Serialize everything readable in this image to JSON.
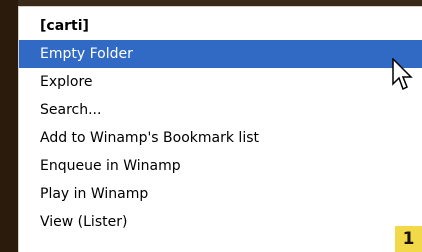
{
  "menu": {
    "header": "[carti]",
    "items": [
      "Empty Folder",
      "Explore",
      "Search...",
      "Add to Winamp's Bookmark list",
      "Enqueue in Winamp",
      "Play in Winamp",
      "View (Lister)"
    ],
    "selected_index": 0
  },
  "badge": {
    "text": "1"
  },
  "cursor": {
    "icon": "mouse-pointer-icon"
  },
  "colors": {
    "selection": "#316ac5",
    "selection_text": "#ffffff",
    "badge_bg": "#f2d94a",
    "backdrop": "#2b1d10"
  }
}
